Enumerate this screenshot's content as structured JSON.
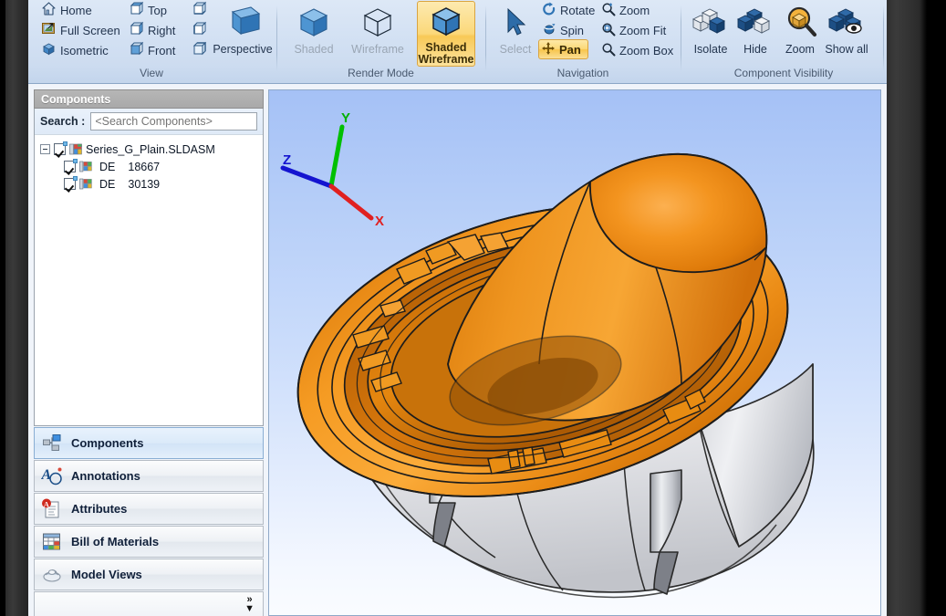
{
  "app": {
    "viewport_bg_top": "#a5c1f6",
    "viewport_bg_bottom": "#fafcff",
    "accent_selected": "#f7c54c"
  },
  "ribbon": {
    "groups": [
      {
        "name": "view",
        "label": "View",
        "small_items": [
          {
            "label": "Home",
            "icon": "home-icon",
            "state": "normal"
          },
          {
            "label": "Full Screen",
            "icon": "full-screen-icon",
            "state": "normal"
          },
          {
            "label": "Isometric",
            "icon": "isometric-cube-icon",
            "state": "normal"
          },
          {
            "label": "Top",
            "icon": "view-top-icon",
            "state": "normal"
          },
          {
            "label": "Right",
            "icon": "view-right-icon",
            "state": "normal"
          },
          {
            "label": "Front",
            "icon": "view-front-icon",
            "state": "normal"
          },
          {
            "label": "",
            "icon": "view-bottom-icon",
            "state": "normal"
          },
          {
            "label": "",
            "icon": "view-left-icon",
            "state": "normal"
          },
          {
            "label": "",
            "icon": "view-back-icon",
            "state": "normal"
          }
        ],
        "big_items": [
          {
            "label": "Perspective",
            "icon": "perspective-box-icon",
            "state": "normal"
          }
        ]
      },
      {
        "name": "render-mode",
        "label": "Render Mode",
        "small_items": [],
        "big_items": [
          {
            "label": "Shaded",
            "icon": "shaded-cube-icon",
            "state": "disabled"
          },
          {
            "label": "Wireframe",
            "icon": "wireframe-cube-icon",
            "state": "disabled"
          },
          {
            "label": "Shaded Wireframe",
            "icon": "shaded-wireframe-cube-icon",
            "state": "selected"
          }
        ]
      },
      {
        "name": "navigation",
        "label": "Navigation",
        "small_items": [
          {
            "label": "Rotate",
            "icon": "rotate-icon",
            "state": "normal"
          },
          {
            "label": "Spin",
            "icon": "spin-icon",
            "state": "normal"
          },
          {
            "label": "Pan",
            "icon": "pan-arrows-icon",
            "state": "selected"
          },
          {
            "label": "Zoom",
            "icon": "zoom-icon",
            "state": "normal"
          },
          {
            "label": "Zoom Fit",
            "icon": "zoom-fit-icon",
            "state": "normal"
          },
          {
            "label": "Zoom Box",
            "icon": "zoom-box-icon",
            "state": "normal"
          }
        ],
        "big_items": [
          {
            "label": "Select",
            "icon": "select-cursor-icon",
            "state": "disabled"
          }
        ]
      },
      {
        "name": "component-visibility",
        "label": "Component Visibility",
        "small_items": [],
        "big_items": [
          {
            "label": "Isolate",
            "icon": "isolate-cubes-icon",
            "state": "normal"
          },
          {
            "label": "Hide",
            "icon": "hide-cubes-icon",
            "state": "normal"
          },
          {
            "label": "Zoom",
            "icon": "zoom-magnifier-cube-icon",
            "state": "normal"
          },
          {
            "label": "Show all",
            "icon": "show-all-cubes-icon",
            "state": "normal"
          }
        ]
      }
    ]
  },
  "components_panel": {
    "title": "Components",
    "search": {
      "label": "Search :",
      "placeholder": "<Search Components>",
      "value": ""
    },
    "tree": [
      {
        "label": "Series_G_Plain.SLDASM",
        "checked": true,
        "expanded": true,
        "level": 0,
        "icon": "assembly-icon"
      },
      {
        "prefix": "DE",
        "label": "18667",
        "checked": true,
        "level": 1,
        "icon": "part-icon"
      },
      {
        "prefix": "DE",
        "label": "30139",
        "checked": true,
        "level": 1,
        "icon": "part-icon"
      }
    ]
  },
  "side_tabs": {
    "items": [
      {
        "label": "Components",
        "icon": "components-tree-icon",
        "selected": true
      },
      {
        "label": "Annotations",
        "icon": "annotations-icon",
        "selected": false
      },
      {
        "label": "Attributes",
        "icon": "attributes-icon",
        "selected": false
      },
      {
        "label": "Bill of Materials",
        "icon": "bom-table-icon",
        "selected": false
      },
      {
        "label": "Model Views",
        "icon": "model-views-icon",
        "selected": false
      }
    ],
    "overflow": {
      "icon": "double-chevron-down-icon",
      "label": "»"
    }
  },
  "viewport": {
    "axis_triad": {
      "x": {
        "label": "X",
        "color": "#e02020"
      },
      "y": {
        "label": "Y",
        "color": "#00c000"
      },
      "z": {
        "label": "Z",
        "color": "#1414d0"
      }
    },
    "model": {
      "name": "Series_G_Plain",
      "part_colors": [
        "#e8850f",
        "#d9d9de"
      ]
    }
  }
}
